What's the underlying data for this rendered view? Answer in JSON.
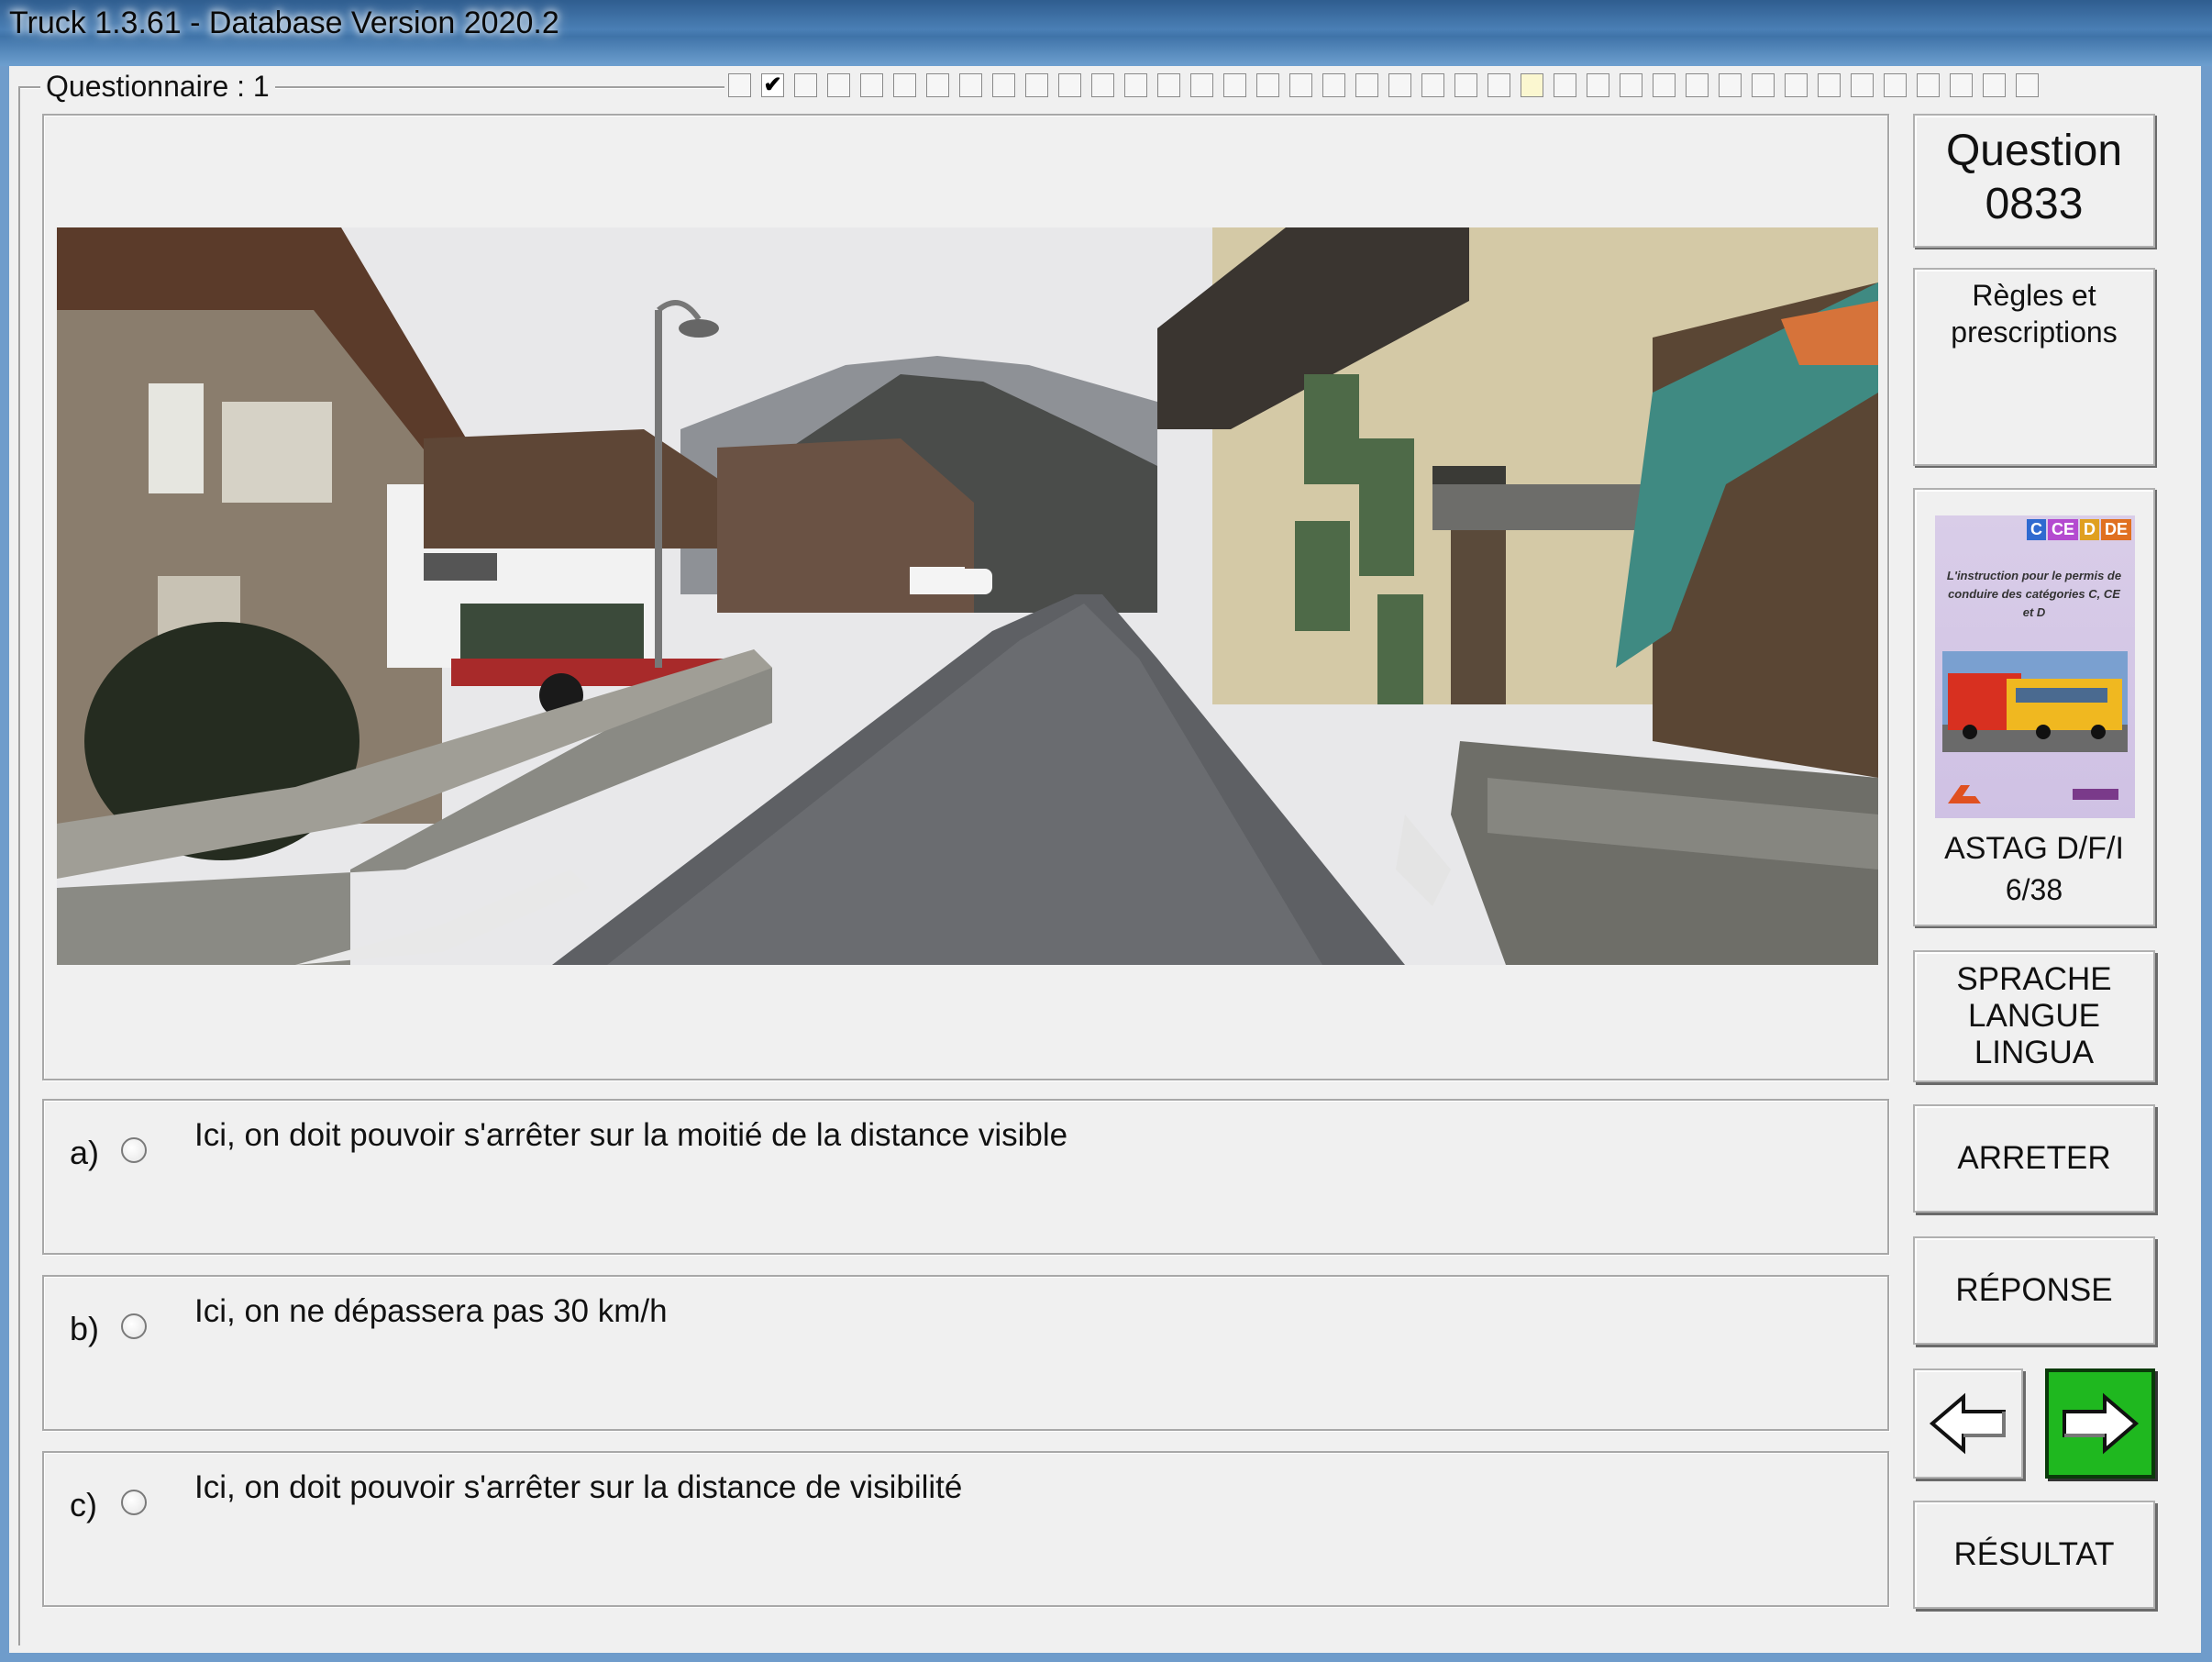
{
  "window": {
    "title": "Truck 1.3.61 - Database Version 2020.2"
  },
  "questionnaire": {
    "label": "Questionnaire : 1",
    "progress_marks": [
      "",
      "✔",
      "",
      "",
      "",
      "",
      "",
      "",
      "",
      "",
      "",
      "",
      "",
      "",
      "",
      "",
      "",
      "",
      "",
      "",
      "",
      "",
      "",
      "",
      "",
      "",
      "",
      "",
      "",
      "",
      "",
      "",
      "",
      "",
      "",
      "",
      "",
      "",
      "",
      ""
    ],
    "current_index": 24
  },
  "question": {
    "heading": "Question",
    "number": "0833",
    "topic": "Règles et prescriptions",
    "image_icon": "street-photo"
  },
  "answers": [
    {
      "letter": "a)",
      "text": "Ici, on doit pouvoir s'arrêter sur la moitié de la distance visible",
      "selected": false
    },
    {
      "letter": "b)",
      "text": "Ici, on ne dépassera pas 30 km/h",
      "selected": false
    },
    {
      "letter": "c)",
      "text": "Ici, on doit pouvoir s'arrêter sur la distance de visibilité",
      "selected": false
    }
  ],
  "reference": {
    "cover_tags": [
      "C",
      "CE",
      "D",
      "DE"
    ],
    "cover_blurb": "L'instruction pour le permis de conduire des catégories C, CE et D",
    "caption": "ASTAG D/F/I",
    "pages": "6/38"
  },
  "buttons": {
    "language": "SPRACHE\nLANGUE\nLINGUA",
    "stop": "ARRETER",
    "answer": "RÉPONSE",
    "result": "RÉSULTAT",
    "prev_icon": "arrow-left-icon",
    "next_icon": "arrow-right-icon"
  },
  "colors": {
    "next_button": "#1fb81f",
    "title_bar": "#4a7fb5",
    "current_progress": "#fbf7d0"
  }
}
